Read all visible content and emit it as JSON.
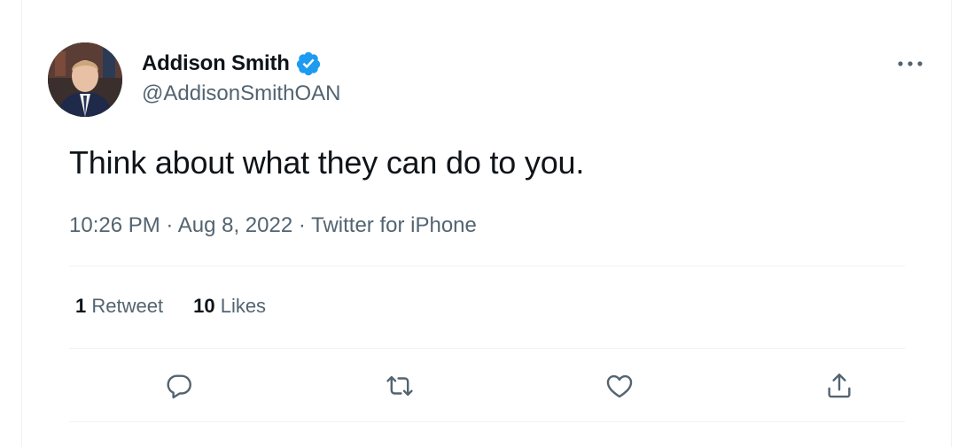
{
  "user": {
    "display_name": "Addison Smith",
    "handle": "@AddisonSmithOAN",
    "verified": true
  },
  "tweet": {
    "text": "Think about what they can do to you.",
    "time": "10:26 PM",
    "separator": "·",
    "date": "Aug 8, 2022",
    "source": "Twitter for iPhone"
  },
  "stats": {
    "retweets_count": "1",
    "retweets_label": "Retweet",
    "likes_count": "10",
    "likes_label": "Likes"
  },
  "icons": {
    "verified": "verified-badge-icon",
    "more": "more-options-icon",
    "reply": "reply-icon",
    "retweet": "retweet-icon",
    "like": "like-icon",
    "share": "share-icon"
  },
  "colors": {
    "verified_blue": "#1d9bf0",
    "text_primary": "#0f1419",
    "text_secondary": "#536471",
    "divider": "#eff3f4"
  }
}
